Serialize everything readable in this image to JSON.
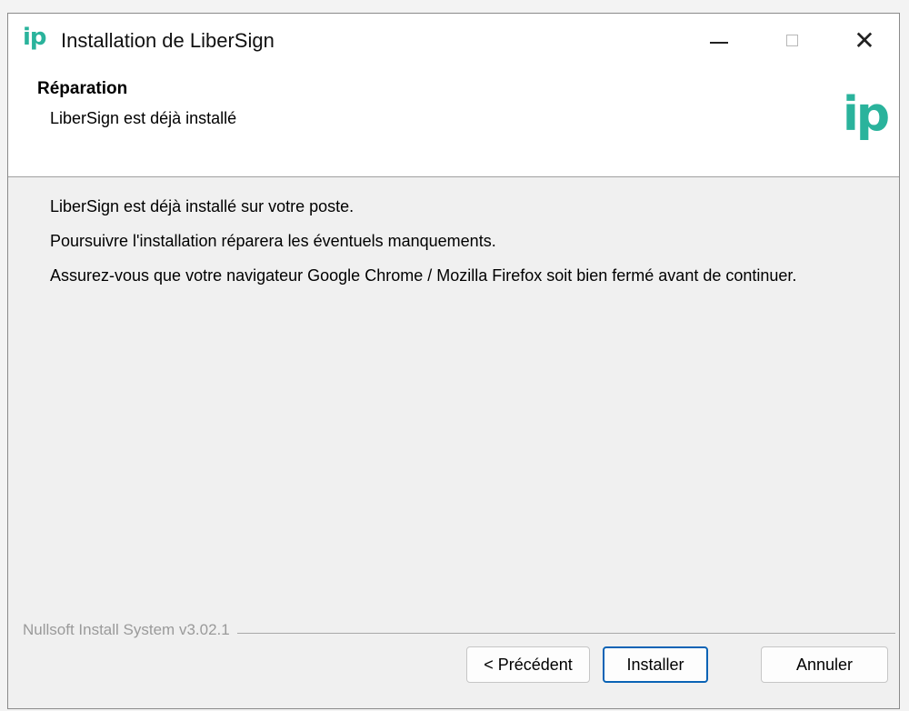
{
  "window": {
    "title": "Installation de LiberSign",
    "icon_text": "ip",
    "controls": {
      "minimize": "minimize-icon",
      "maximize": "maximize-icon",
      "close": "close-icon",
      "close_glyph": "✕"
    }
  },
  "header": {
    "title": "Réparation",
    "subtitle": "LiberSign est déjà installé",
    "logo_text": "ip",
    "logo_color": "#2ab39c"
  },
  "body": {
    "paragraphs": [
      "LiberSign est déjà installé sur votre poste.",
      "Poursuivre l'installation réparera les éventuels manquements.",
      "Assurez-vous que votre navigateur Google Chrome / Mozilla Firefox soit bien fermé avant de continuer."
    ]
  },
  "footer": {
    "branding": "Nullsoft Install System v3.02.1",
    "buttons": {
      "previous": "< Précédent",
      "install": "Installer",
      "cancel": "Annuler"
    },
    "default_button_border": "#0a63b5"
  }
}
